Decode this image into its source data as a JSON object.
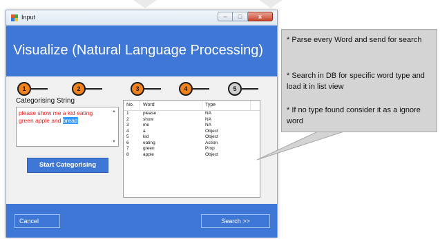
{
  "window": {
    "title": "Input",
    "close_glyph": "x"
  },
  "header": {
    "title": "Visualize (Natural Language Processing)"
  },
  "steps": [
    {
      "label": "1",
      "state": "active"
    },
    {
      "label": "2",
      "state": "active"
    },
    {
      "label": "3",
      "state": "active"
    },
    {
      "label": "4",
      "state": "active"
    },
    {
      "label": "5",
      "state": "inactive"
    }
  ],
  "input": {
    "label": "Categorising String",
    "text_before": "please show me a kid eating green apple and ",
    "text_selected": "bread"
  },
  "start_button": {
    "label": "Start Categorising"
  },
  "list": {
    "columns": [
      "No.",
      "Word",
      "Type"
    ],
    "rows": [
      [
        "1",
        "please",
        "NA"
      ],
      [
        "2",
        "show",
        "NA"
      ],
      [
        "3",
        "me",
        "NA"
      ],
      [
        "4",
        "a",
        "Object"
      ],
      [
        "5",
        "kid",
        "Object"
      ],
      [
        "6",
        "eating",
        "Action"
      ],
      [
        "7",
        "green",
        "Prop"
      ],
      [
        "8",
        "apple",
        "Object"
      ]
    ]
  },
  "footer": {
    "cancel_label": "Cancel",
    "search_label": "Search >>"
  },
  "notes": [
    "* Parse every Word and send for search",
    "* Search in DB for specific word type and load it in list view",
    "* If no type found consider it as a ignore word"
  ],
  "colors": {
    "accent": "#3f77d6",
    "step_active": "#f0831e",
    "step_inactive": "#cfcfcf",
    "input_text": "#e11b1b"
  }
}
